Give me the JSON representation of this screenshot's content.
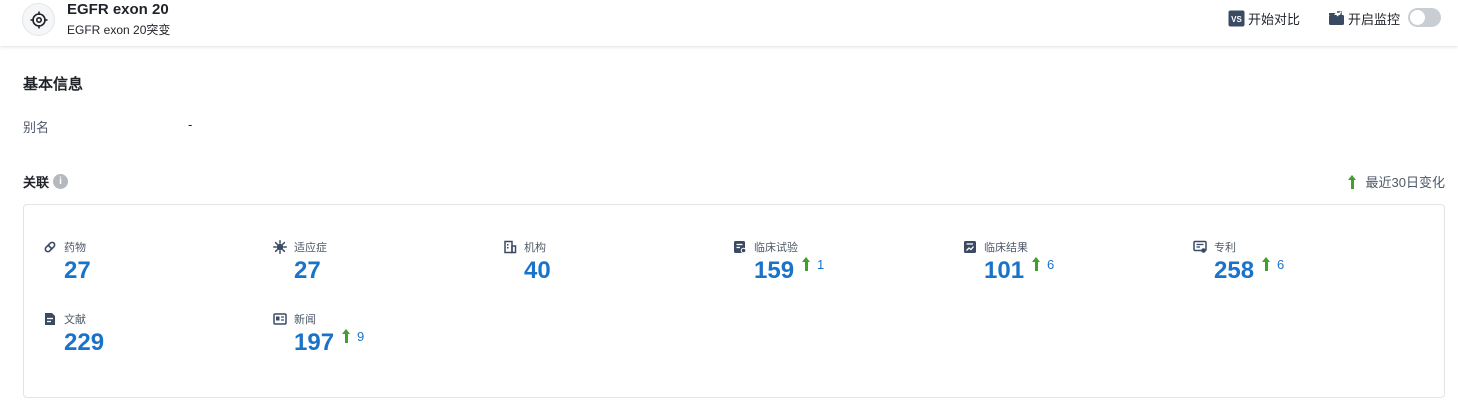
{
  "header": {
    "title": "EGFR exon 20",
    "subtitle": "EGFR exon 20突变",
    "compare_label": "开始对比",
    "compare_icon_text": "VS",
    "monitor_label": "开启监控",
    "monitor_enabled": false
  },
  "basic_info": {
    "title": "基本信息",
    "alias_label": "别名",
    "alias_value": "-"
  },
  "relations": {
    "title": "关联",
    "info_icon": "i",
    "legend_label": "最近30日变化",
    "items": [
      {
        "label": "药物",
        "icon": "pill-icon",
        "value": "27",
        "delta": ""
      },
      {
        "label": "适应症",
        "icon": "virus-icon",
        "value": "27",
        "delta": ""
      },
      {
        "label": "机构",
        "icon": "building-icon",
        "value": "40",
        "delta": ""
      },
      {
        "label": "临床试验",
        "icon": "clinical-trial-icon",
        "value": "159",
        "delta": "1"
      },
      {
        "label": "临床结果",
        "icon": "clinical-result-icon",
        "value": "101",
        "delta": "6"
      },
      {
        "label": "专利",
        "icon": "patent-icon",
        "value": "258",
        "delta": "6"
      },
      {
        "label": "文献",
        "icon": "document-icon",
        "value": "229",
        "delta": ""
      },
      {
        "label": "新闻",
        "icon": "news-icon",
        "value": "197",
        "delta": "9"
      }
    ]
  },
  "colors": {
    "accent": "#1a73c9",
    "increase": "#3fa12c",
    "text": "#1f2329",
    "muted": "#4e5969"
  }
}
